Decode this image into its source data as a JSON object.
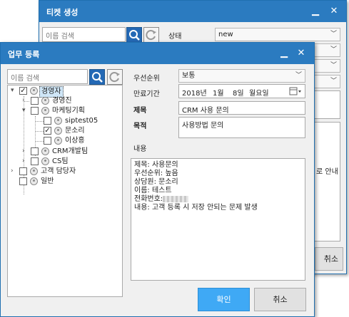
{
  "back_window": {
    "title": "티켓 생성",
    "controls": {
      "minimize": "▁",
      "close": "✕"
    },
    "search": {
      "placeholder": "이름 검색"
    },
    "status_label": "상태",
    "status_value": "new",
    "partial_text": "로 안내",
    "cancel_partial": "취소"
  },
  "dialog": {
    "title": "업무 등록",
    "controls": {
      "minimize": "▁",
      "close": "✕"
    },
    "search": {
      "placeholder": "이름 검색"
    },
    "tree": [
      {
        "label": "경영자",
        "checked": true,
        "expanded": true,
        "level": 0
      },
      {
        "label": "경영진",
        "checked": false,
        "expanded": false,
        "level": 1
      },
      {
        "label": "마케팅기획",
        "checked": false,
        "expanded": true,
        "level": 1
      },
      {
        "label": "siptest05",
        "checked": false,
        "level": 2
      },
      {
        "label": "문소리",
        "checked": true,
        "level": 2
      },
      {
        "label": "이상흥",
        "checked": false,
        "level": 2
      },
      {
        "label": "CRM개발팀",
        "checked": false,
        "expanded": false,
        "level": 1
      },
      {
        "label": "CS팀",
        "checked": false,
        "expanded": false,
        "level": 1
      },
      {
        "label": "고객 담당자",
        "checked": false,
        "expanded": false,
        "level": 0
      },
      {
        "label": "일반",
        "checked": false,
        "level": 0
      }
    ],
    "fields": {
      "priority_label": "우선순위",
      "priority_value": "보통",
      "due_label": "만료기간",
      "due_year": "2018년",
      "due_month": "1월",
      "due_day": "8일",
      "due_weekday": "월요일",
      "title_label": "제목",
      "title_value": "CRM 사용 문의",
      "purpose_label": "목적",
      "purpose_value": "사용방법 문의",
      "content_label": "내용",
      "content_lines": [
        "제목: 사용문의",
        "우선순위: 높음",
        "상담원: 문소리",
        "이름: 테스트",
        "전화번호:",
        "내용: 고객 등록 시 저장 안되는 문제 발생"
      ]
    },
    "buttons": {
      "confirm": "확인",
      "cancel": "취소"
    },
    "colors": {
      "titlebar": "#2b7bc0",
      "confirm_bg": "#3fa9f5",
      "accent": "#2469b5"
    }
  }
}
